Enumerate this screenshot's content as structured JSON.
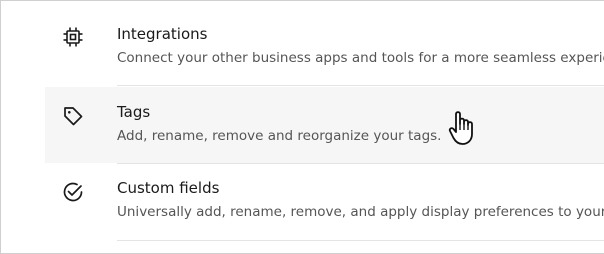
{
  "settings_list": {
    "items": [
      {
        "icon": "chip-icon",
        "title": "Integrations",
        "description": "Connect your other business apps and tools for a more seamless experience"
      },
      {
        "icon": "tag-icon",
        "title": "Tags",
        "description": "Add, rename, remove and reorganize your tags."
      },
      {
        "icon": "check-circle-icon",
        "title": "Custom fields",
        "description": "Universally add, rename, remove, and apply display preferences to your custom fields."
      }
    ]
  },
  "cursor": {
    "type": "hand-pointer-icon"
  }
}
